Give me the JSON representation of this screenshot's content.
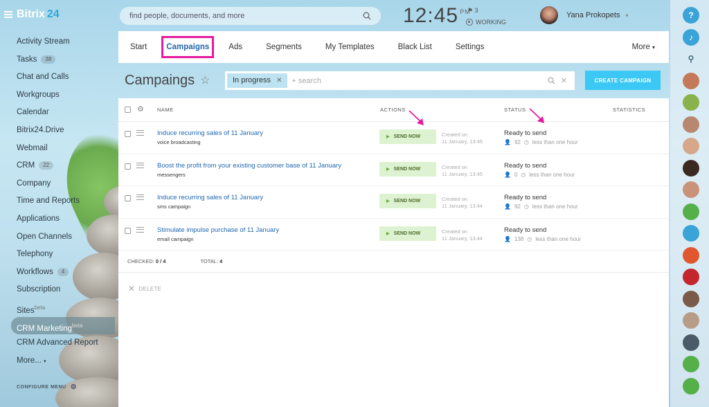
{
  "app": {
    "logo_main": "Bitrix",
    "logo_num": "24"
  },
  "search": {
    "placeholder": "find people, documents, and more"
  },
  "header": {
    "time": "12:45",
    "ampm": "PM",
    "flag_count": "3",
    "working": "WORKING",
    "user_name": "Yana Prokopets"
  },
  "sidebar": {
    "items": [
      {
        "label": "Activity Stream"
      },
      {
        "label": "Tasks",
        "count": "38"
      },
      {
        "label": "Chat and Calls"
      },
      {
        "label": "Workgroups"
      },
      {
        "label": "Calendar"
      },
      {
        "label": "Bitrix24.Drive"
      },
      {
        "label": "Webmail"
      },
      {
        "label": "CRM",
        "count": "22"
      },
      {
        "label": "Company"
      },
      {
        "label": "Time and Reports"
      },
      {
        "label": "Applications"
      },
      {
        "label": "Open Channels"
      },
      {
        "label": "Telephony"
      },
      {
        "label": "Workflows",
        "count": "4"
      },
      {
        "label": "Subscription"
      },
      {
        "label": "Sites",
        "sup": "beta"
      },
      {
        "label": "CRM Marketing",
        "sup": "beta",
        "active": true
      },
      {
        "label": "CRM Advanced Report"
      },
      {
        "label": "More..."
      }
    ],
    "configure": "CONFIGURE MENU"
  },
  "tabs": [
    "Start",
    "Campaigns",
    "Ads",
    "Segments",
    "My Templates",
    "Black List",
    "Settings"
  ],
  "tab_more": "More",
  "page": {
    "title": "Campaings",
    "filter_chip": "In progress",
    "filter_placeholder": "+ search",
    "create_button": "CREATE CAMPAIGN"
  },
  "grid": {
    "headers": {
      "name": "NAME",
      "actions": "ACTIONS",
      "status": "STATUS",
      "statistics": "STATISTICS"
    },
    "rows": [
      {
        "name": "Induce recurring sales of 11 January",
        "type": "voice broadcasting",
        "action": "SEND NOW",
        "created_label": "Created on",
        "created": "11 January, 13:45",
        "status": "Ready to send",
        "recipients": "92",
        "eta": "less than one hour"
      },
      {
        "name": "Boost the profit from your existing customer base of 11 January",
        "type": "messengers",
        "action": "SEND NOW",
        "created_label": "Created on",
        "created": "11 January, 13:45",
        "status": "Ready to send",
        "recipients": "0",
        "eta": "less than one hour"
      },
      {
        "name": "Induce recurring sales of 11 January",
        "type": "sms campaign",
        "action": "SEND NOW",
        "created_label": "Created on",
        "created": "11 January, 13:44",
        "status": "Ready to send",
        "recipients": "92",
        "eta": "less than one hour"
      },
      {
        "name": "Stimulate impulse purchase of 11 January",
        "type": "email campaign",
        "action": "SEND NOW",
        "created_label": "Created on",
        "created": "11 January, 13:44",
        "status": "Ready to send",
        "recipients": "138",
        "eta": "less than one hour"
      }
    ],
    "footer": {
      "checked_label": "CHECKED:",
      "checked": "0 / 4",
      "total_label": "TOTAL:",
      "total": "4"
    },
    "delete": "DELETE"
  },
  "colors": {
    "accent": "#3bc8f5",
    "highlight": "#e5199f",
    "link": "#2067b0",
    "send_bg": "#ddf2d0"
  },
  "rightbar": {
    "icons": [
      "help-icon",
      "bell-icon",
      "search-icon",
      "megaphone-avatar",
      "green-avatar",
      "user-avatar",
      "user-avatar",
      "user-avatar",
      "user-avatar",
      "lock-icon",
      "megaphone-icon",
      "megaphone-icon",
      "red-avatar",
      "user-avatar",
      "user-avatar",
      "user-avatar",
      "megaphone-icon",
      "phone-icon"
    ],
    "help_label": "?"
  }
}
